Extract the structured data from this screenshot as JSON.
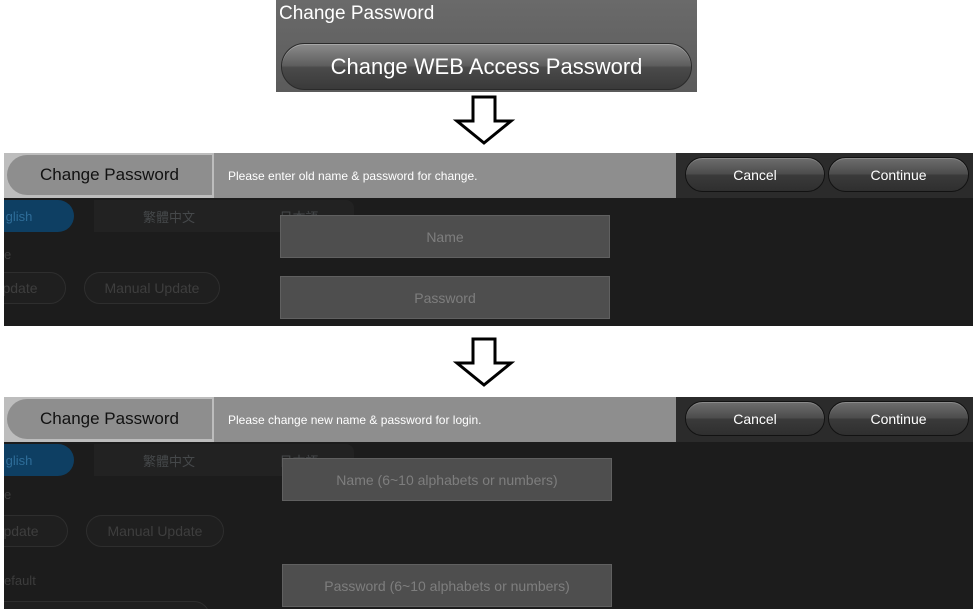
{
  "change_password_section": {
    "title": "Change Password",
    "button_label": "Change WEB Access Password"
  },
  "background": {
    "languages": [
      "glish",
      "繁體中文",
      "日本語"
    ],
    "label_e": "e",
    "auto_update_label": "pdate",
    "manual_update_label": "Manual Update",
    "default_label": "efault"
  },
  "step_old": {
    "title": "Change Password",
    "message": "Please enter old name & password for change.",
    "cancel_label": "Cancel",
    "continue_label": "Continue",
    "name_placeholder": "Name",
    "password_placeholder": "Password"
  },
  "step_new": {
    "title": "Change Password",
    "message": "Please change new name & password for login.",
    "cancel_label": "Cancel",
    "continue_label": "Continue",
    "name_placeholder": "Name (6~10 alphabets or numbers)",
    "password_placeholder": "Password (6~10 alphabets or numbers)"
  },
  "colors": {
    "header_bar": "#8e8e8e",
    "dialog_background": "#1c1c1c",
    "field_background": "#4e4e4e",
    "language_selected": "#0e3f63"
  },
  "icons": [
    "down-arrow-icon"
  ]
}
